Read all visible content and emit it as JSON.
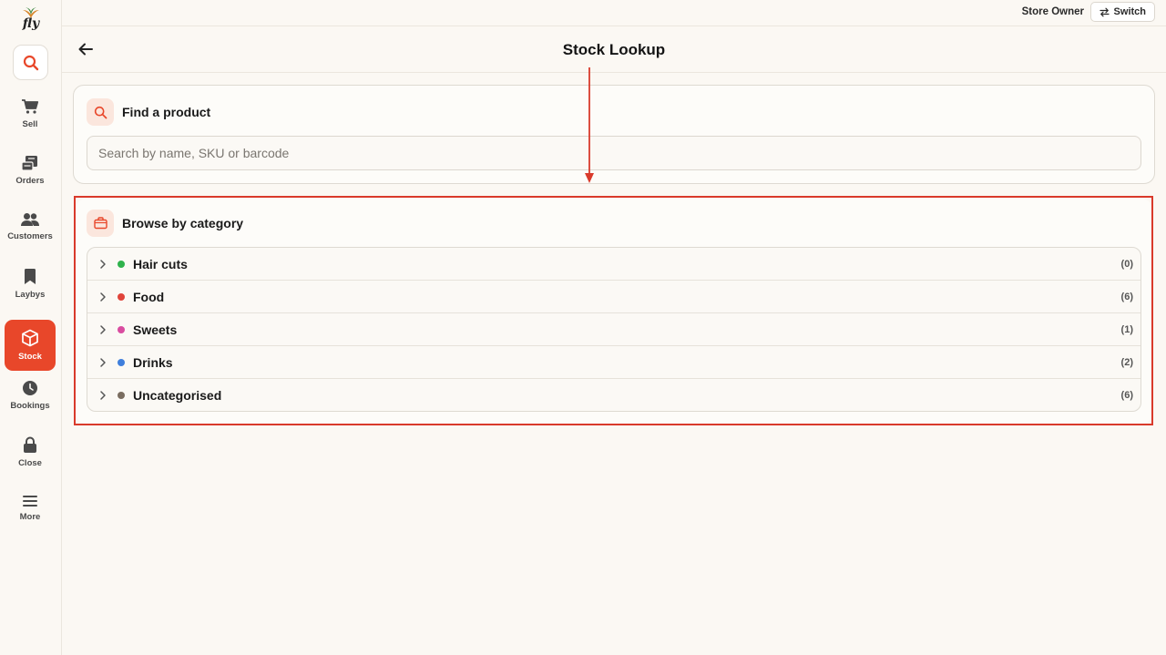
{
  "app": {
    "logo_text": "fly"
  },
  "sidebar": {
    "items": [
      {
        "label": "Sell",
        "icon": "cart-icon",
        "active": false
      },
      {
        "label": "Orders",
        "icon": "receipt-icon",
        "active": false
      },
      {
        "label": "Customers",
        "icon": "people-icon",
        "active": false
      },
      {
        "label": "Laybys",
        "icon": "bookmark-icon",
        "active": false
      },
      {
        "label": "Stock",
        "icon": "box-icon",
        "active": true
      },
      {
        "label": "Bookings",
        "icon": "clock-icon",
        "active": false
      },
      {
        "label": "Close",
        "icon": "lock-icon",
        "active": false
      },
      {
        "label": "More",
        "icon": "menu-icon",
        "active": false
      }
    ]
  },
  "topbar": {
    "user": "Store Owner",
    "switch_label": "Switch"
  },
  "header": {
    "title": "Stock Lookup"
  },
  "find": {
    "title": "Find a product",
    "placeholder": "Search by name, SKU or barcode",
    "value": ""
  },
  "browse": {
    "title": "Browse by category",
    "categories": [
      {
        "name": "Hair cuts",
        "count": "(0)",
        "color": "#2fb24c"
      },
      {
        "name": "Food",
        "count": "(6)",
        "color": "#e0443a"
      },
      {
        "name": "Sweets",
        "count": "(1)",
        "color": "#d94ca0"
      },
      {
        "name": "Drinks",
        "count": "(2)",
        "color": "#3f7fdc"
      },
      {
        "name": "Uncategorised",
        "count": "(6)",
        "color": "#7a6d60"
      }
    ]
  },
  "colors": {
    "accent": "#e8472a",
    "annotation": "#d93a2b"
  }
}
